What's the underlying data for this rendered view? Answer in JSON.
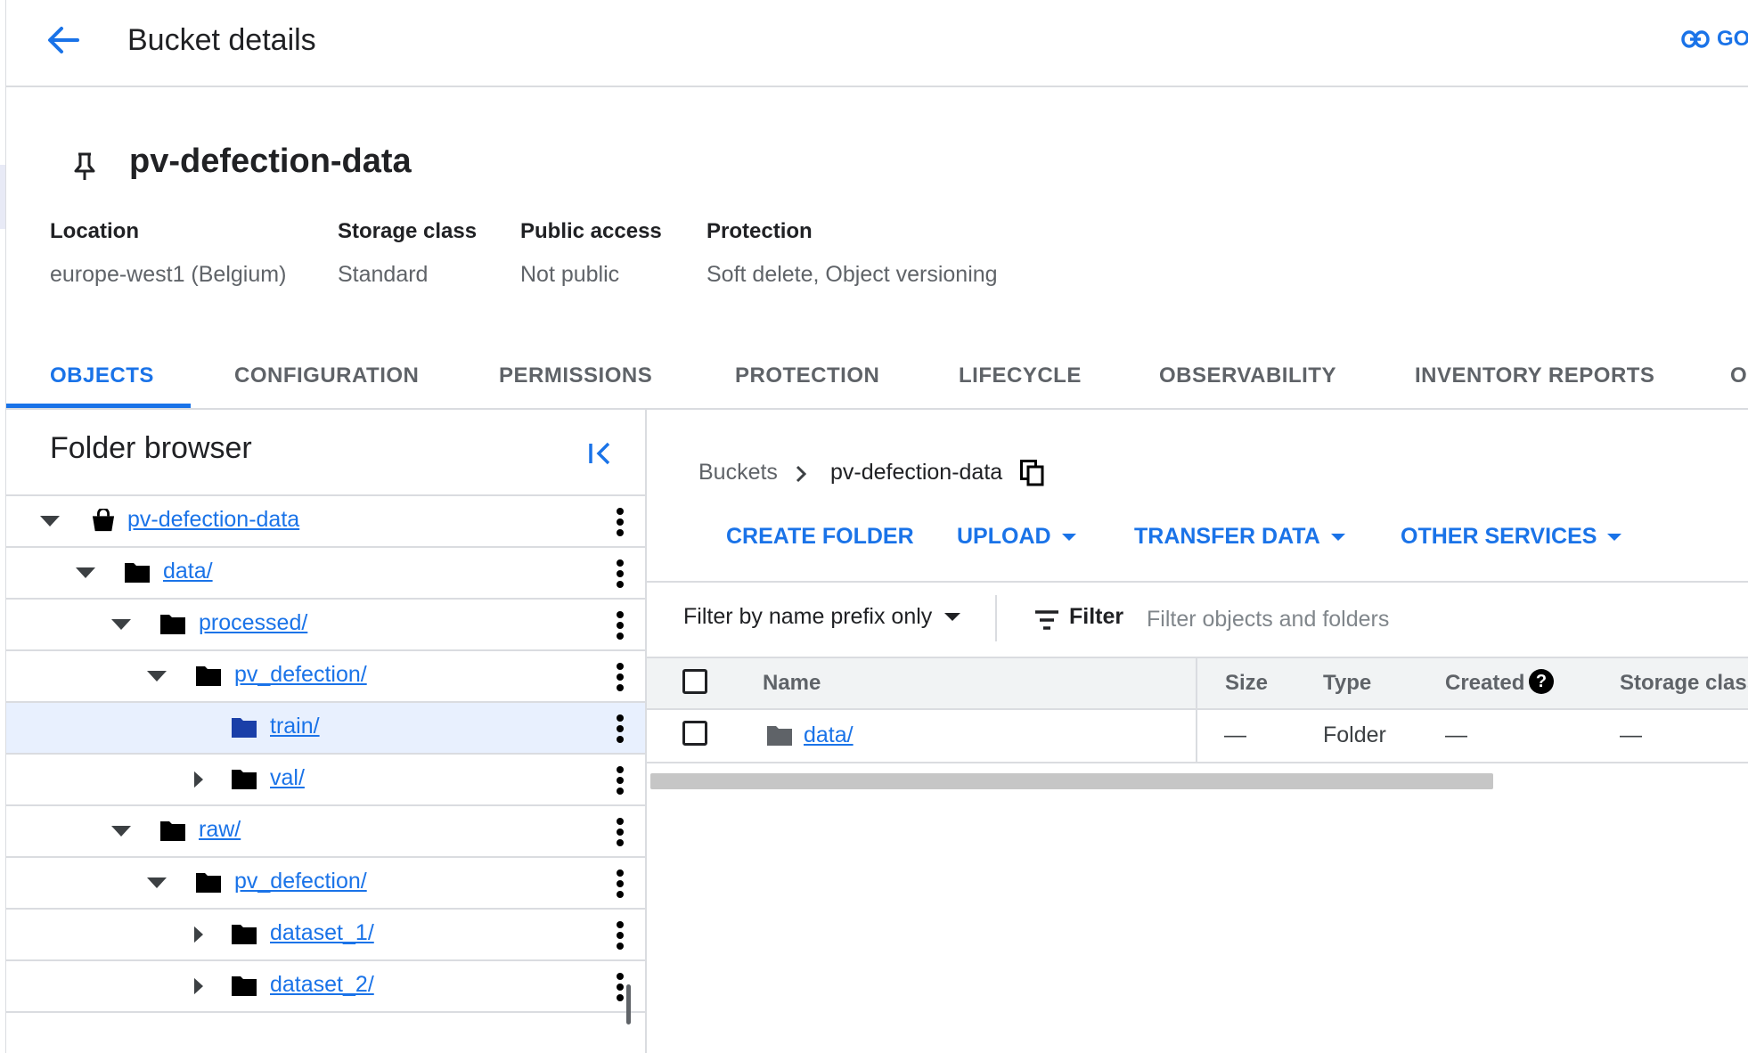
{
  "header": {
    "title": "Bucket details",
    "link_label": "GO"
  },
  "bucket": {
    "name": "pv-defection-data",
    "properties": [
      {
        "label": "Location",
        "value": "europe-west1 (Belgium)"
      },
      {
        "label": "Storage class",
        "value": "Standard"
      },
      {
        "label": "Public access",
        "value": "Not public"
      },
      {
        "label": "Protection",
        "value": "Soft delete, Object versioning"
      }
    ]
  },
  "tabs": [
    {
      "label": "OBJECTS",
      "active": true
    },
    {
      "label": "CONFIGURATION",
      "active": false
    },
    {
      "label": "PERMISSIONS",
      "active": false
    },
    {
      "label": "PROTECTION",
      "active": false
    },
    {
      "label": "LIFECYCLE",
      "active": false
    },
    {
      "label": "OBSERVABILITY",
      "active": false
    },
    {
      "label": "INVENTORY REPORTS",
      "active": false
    },
    {
      "label": "O",
      "active": false
    }
  ],
  "folder_browser": {
    "title": "Folder browser",
    "tree": [
      {
        "label": "pv-defection-data",
        "type": "bucket",
        "expanded": true
      },
      {
        "label": "data/",
        "type": "folder",
        "expanded": true
      },
      {
        "label": "processed/",
        "type": "folder",
        "expanded": true
      },
      {
        "label": "pv_defection/",
        "type": "folder",
        "expanded": true
      },
      {
        "label": "train/",
        "type": "folder",
        "selected": true
      },
      {
        "label": "val/",
        "type": "folder",
        "expanded": false
      },
      {
        "label": "raw/",
        "type": "folder",
        "expanded": true
      },
      {
        "label": "pv_defection/",
        "type": "folder",
        "expanded": true
      },
      {
        "label": "dataset_1/",
        "type": "folder",
        "expanded": false
      },
      {
        "label": "dataset_2/",
        "type": "folder",
        "expanded": false
      }
    ]
  },
  "breadcrumb": {
    "root": "Buckets",
    "current": "pv-defection-data"
  },
  "actions": {
    "create_folder": "CREATE FOLDER",
    "upload": "UPLOAD",
    "transfer_data": "TRANSFER DATA",
    "other_services": "OTHER SERVICES"
  },
  "filter": {
    "prefix_label": "Filter by name prefix only",
    "label": "Filter",
    "placeholder": "Filter objects and folders"
  },
  "table": {
    "columns": {
      "name": "Name",
      "size": "Size",
      "type": "Type",
      "created": "Created",
      "storage_class": "Storage class"
    },
    "rows": [
      {
        "name": "data/",
        "size": "—",
        "type": "Folder",
        "created": "—",
        "storage_class": "—"
      }
    ]
  },
  "colors": {
    "accent": "#1a73e8",
    "text": "#202124",
    "muted": "#5f6368",
    "border": "#dadce0",
    "selected_row": "#e8f0fe"
  }
}
